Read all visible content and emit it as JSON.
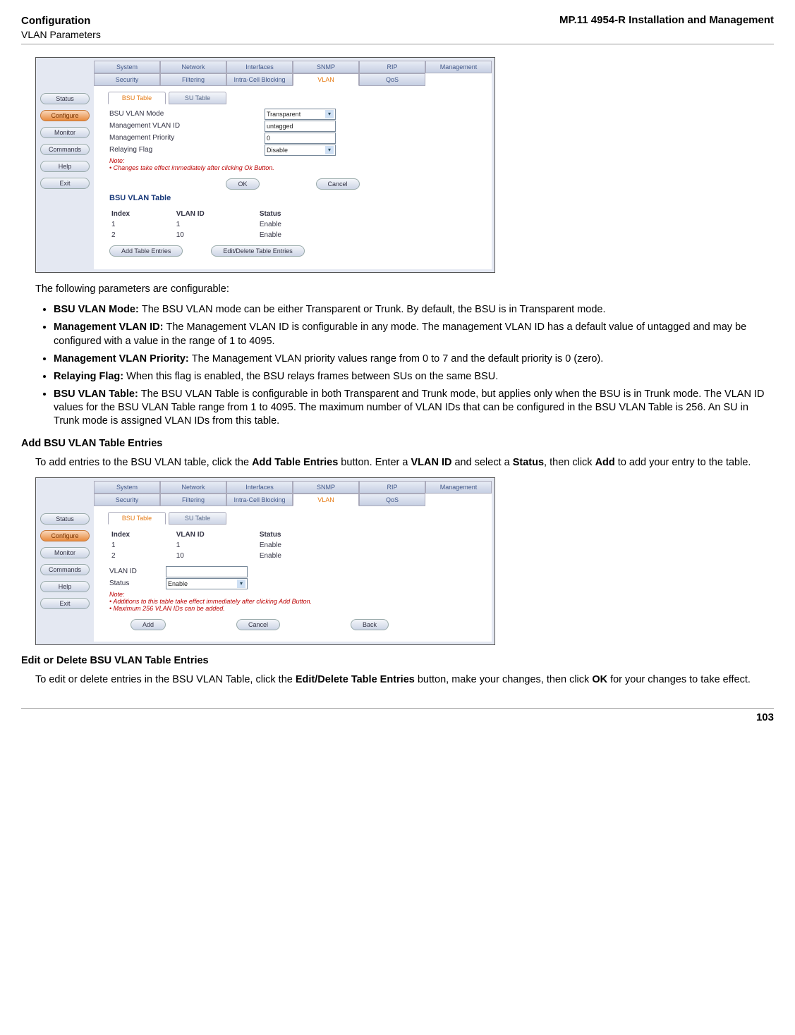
{
  "header": {
    "left_title": "Configuration",
    "left_sub": "VLAN Parameters",
    "right": "MP.11 4954-R Installation and Management"
  },
  "footer": {
    "page": "103"
  },
  "sidenav": {
    "items": [
      "Status",
      "Configure",
      "Monitor",
      "Commands",
      "Help",
      "Exit"
    ],
    "active_index": 1
  },
  "topTabs": {
    "row1": [
      "System",
      "Network",
      "Interfaces",
      "SNMP",
      "RIP",
      "Management"
    ],
    "row2": [
      "Security",
      "Filtering",
      "Intra-Cell Blocking",
      "VLAN",
      "QoS"
    ],
    "row2_active_index": 3
  },
  "subtabs": {
    "items": [
      "BSU Table",
      "SU Table"
    ],
    "active_index": 0
  },
  "shot1": {
    "fields": [
      {
        "label": "BSU VLAN Mode",
        "value": "Transparent",
        "dropdown": true
      },
      {
        "label": "Management VLAN ID",
        "value": "untagged",
        "dropdown": false
      },
      {
        "label": "Management Priority",
        "value": "0",
        "dropdown": false
      },
      {
        "label": "Relaying Flag",
        "value": "Disable",
        "dropdown": true
      }
    ],
    "note_label": "Note:",
    "note_line": "Changes take effect immediately after clicking Ok Button.",
    "btn_ok": "OK",
    "btn_cancel": "Cancel",
    "table_title": "BSU VLAN Table",
    "table_headers": [
      "Index",
      "VLAN ID",
      "Status"
    ],
    "table_rows": [
      {
        "index": "1",
        "vlan": "1",
        "status": "Enable"
      },
      {
        "index": "2",
        "vlan": "10",
        "status": "Enable"
      }
    ],
    "btn_add": "Add Table Entries",
    "btn_edit": "Edit/Delete Table Entries"
  },
  "shot2": {
    "table_headers": [
      "Index",
      "VLAN ID",
      "Status"
    ],
    "table_rows": [
      {
        "index": "1",
        "vlan": "1",
        "status": "Enable"
      },
      {
        "index": "2",
        "vlan": "10",
        "status": "Enable"
      }
    ],
    "vlan_id_label": "VLAN ID",
    "status_label": "Status",
    "status_value": "Enable",
    "note_label": "Note:",
    "note_line1": "Additions to this table take effect immediately after clicking Add Button.",
    "note_line2": "Maximum 256 VLAN IDs can be added.",
    "btn_add": "Add",
    "btn_cancel": "Cancel",
    "btn_back": "Back"
  },
  "doc": {
    "intro": "The following parameters are configurable:",
    "b1_lead": "BSU VLAN Mode: ",
    "b1": "The BSU VLAN mode can be either Transparent or Trunk. By default, the BSU is in Transparent mode.",
    "b2_lead": "Management VLAN ID: ",
    "b2": "The Management VLAN ID is configurable in any mode. The management VLAN ID has a default value of untagged and may be configured with a value in the range of 1 to 4095.",
    "b3_lead": "Management VLAN Priority: ",
    "b3": "The Management VLAN priority values range from 0 to 7 and the default priority is 0 (zero).",
    "b4_lead": "Relaying Flag: ",
    "b4": "When this flag is enabled, the BSU relays frames between SUs on the same BSU.",
    "b5_lead": "BSU VLAN Table: ",
    "b5": "The BSU VLAN Table is configurable in both Transparent and Trunk mode, but applies only when the BSU is in Trunk mode. The VLAN ID values for the BSU VLAN Table range from 1 to 4095. The maximum number of VLAN IDs that can be configured in the BSU VLAN Table is 256. An SU in Trunk mode is assigned VLAN IDs from this table.",
    "sec_add_title": "Add BSU VLAN Table Entries",
    "sec_add_p1a": "To add entries to the BSU VLAN table, click the ",
    "sec_add_p1b": "Add Table Entries",
    "sec_add_p1c": " button. Enter a ",
    "sec_add_p1d": "VLAN ID",
    "sec_add_p1e": " and select a ",
    "sec_add_p1f": "Status",
    "sec_add_p1g": ", then click ",
    "sec_add_p1h": "Add",
    "sec_add_p1i": " to add your entry to the table.",
    "sec_edit_title": "Edit or Delete BSU VLAN Table Entries",
    "sec_edit_p1a": "To edit or delete entries in the BSU VLAN Table, click the ",
    "sec_edit_p1b": "Edit/Delete Table Entries",
    "sec_edit_p1c": " button, make your changes, then click ",
    "sec_edit_p1d": "OK",
    "sec_edit_p1e": " for your changes to take effect."
  }
}
